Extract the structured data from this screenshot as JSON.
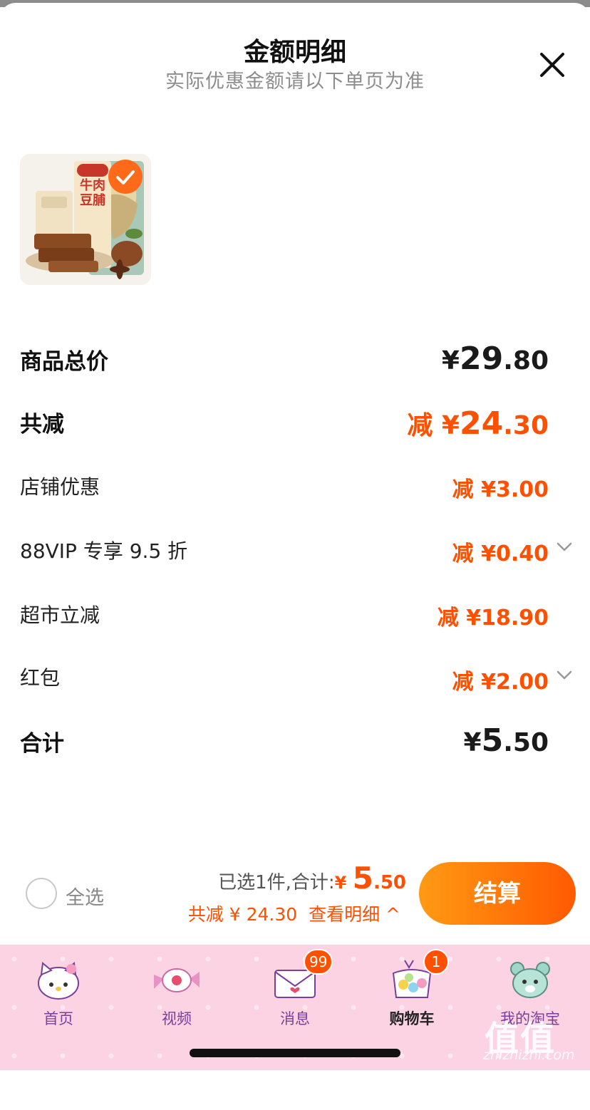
{
  "header": {
    "title": "金额明细",
    "subtitle": "实际优惠金额请以下单页为准",
    "close_icon": "close-icon"
  },
  "product": {
    "image_icon": "product-thumbnail",
    "package_text": "牛肉豆脯",
    "selected": true
  },
  "price_rows": {
    "total": {
      "label": "商品总价",
      "yen": "¥",
      "int": "29",
      "dec": ".80"
    },
    "reduction": {
      "label": "共减",
      "prefix": "减 ",
      "yen": "¥",
      "int": "24",
      "dec": ".30"
    },
    "store_discount": {
      "label": "店铺优惠",
      "prefix": "减 ",
      "yen": "¥",
      "int": "3",
      "dec": ".00"
    },
    "vip_discount": {
      "label": "88VIP 专享 9.5 折",
      "prefix": "减 ",
      "yen": "¥",
      "int": "0",
      "dec": ".40",
      "expand_icon": "chevron-down-icon"
    },
    "supermarket": {
      "label": "超市立减",
      "prefix": "减 ",
      "yen": "¥",
      "int": "18",
      "dec": ".90"
    },
    "red_packet": {
      "label": "红包",
      "prefix": "减 ",
      "yen": "¥",
      "int": "2",
      "dec": ".00",
      "expand_icon": "chevron-down-icon"
    },
    "subtotal": {
      "label": "合计",
      "yen": "¥",
      "int": "5",
      "dec": ".50"
    }
  },
  "checkout_bar": {
    "select_all_label": "全选",
    "selected_text": "已选1件,合计:",
    "amount_yen": "¥ ",
    "amount_int": "5",
    "amount_dec": ".50",
    "reduced_text": "共减 ¥ 24.30",
    "detail_link": "查看明细",
    "detail_chevron": "^",
    "checkout_label": "结算"
  },
  "tabbar": {
    "tabs": [
      {
        "label": "首页",
        "icon": "hello-kitty-home-icon",
        "badge": "",
        "active": false
      },
      {
        "label": "视频",
        "icon": "candy-video-icon",
        "badge": "",
        "active": false
      },
      {
        "label": "消息",
        "icon": "envelope-message-icon",
        "badge": "99",
        "active": false
      },
      {
        "label": "购物车",
        "icon": "candy-cart-icon",
        "badge": "1",
        "active": true
      },
      {
        "label": "我的淘宝",
        "icon": "bear-profile-icon",
        "badge": "",
        "active": false
      }
    ]
  },
  "watermark": {
    "logo_text": "值",
    "site": "zhizhizhi.com"
  },
  "colors": {
    "accent": "#ff5000",
    "checkout_gradient_start": "#ff9a14",
    "checkout_gradient_end": "#ff5a00",
    "tabbar_bg": "#fbd3e3",
    "tab_label": "#7a3e9c"
  }
}
